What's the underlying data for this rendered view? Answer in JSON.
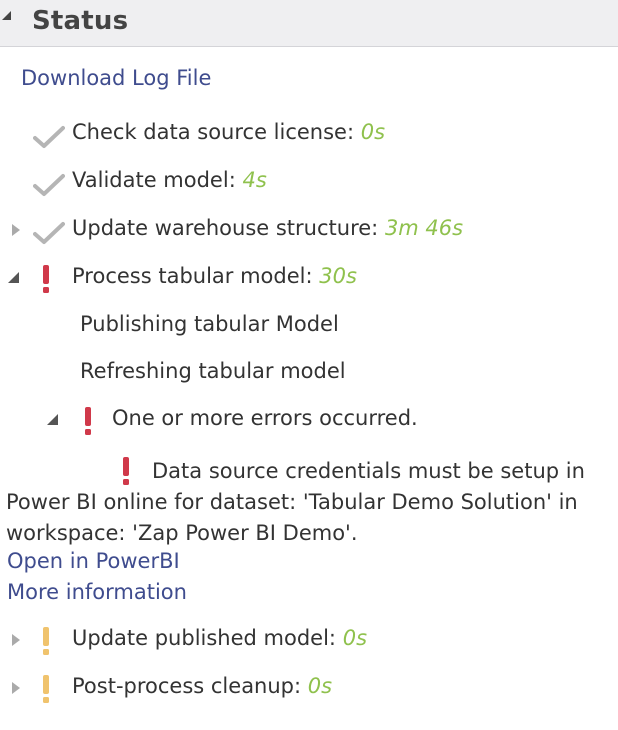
{
  "header": {
    "title": "Status"
  },
  "download_link": "Download Log File",
  "steps": [
    {
      "label": "Check data source license:",
      "duration": "0s",
      "status": "success"
    },
    {
      "label": "Validate model:",
      "duration": "4s",
      "status": "success"
    },
    {
      "label": "Update warehouse structure:",
      "duration": "3m 46s",
      "status": "success"
    },
    {
      "label": "Process tabular model:",
      "duration": "30s",
      "status": "error"
    },
    {
      "label": "Update published model:",
      "duration": "0s",
      "status": "warning"
    },
    {
      "label": "Post-process cleanup:",
      "duration": "0s",
      "status": "warning"
    }
  ],
  "substeps": [
    "Publishing tabular Model",
    "Refreshing tabular model"
  ],
  "error_group": {
    "label": "One or more errors occurred."
  },
  "error_detail": {
    "line1": "Data source credentials must be setup in",
    "rest": "Power BI online for dataset: 'Tabular Demo Solution' in workspace: 'Zap Power BI Demo'."
  },
  "links": {
    "open_powerbi": "Open in PowerBI",
    "more_info": "More information"
  },
  "colors": {
    "success": "#b5b5b5",
    "error": "#d0394a",
    "warning": "#f0c36d",
    "duration": "#8fc14d",
    "link": "#3f4c8e"
  }
}
